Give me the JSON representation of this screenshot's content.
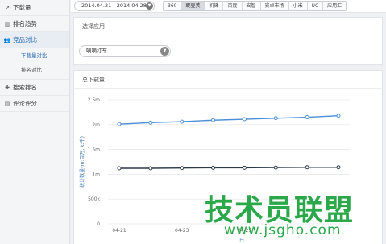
{
  "sidebar": {
    "items": [
      {
        "label": "下载量",
        "icon": "line-chart-icon"
      },
      {
        "label": "排名趋势",
        "icon": "bar-chart-icon"
      },
      {
        "label": "竞品对比",
        "icon": "users-icon",
        "active": true,
        "subitems": [
          {
            "label": "下载量对比",
            "active": true
          },
          {
            "label": "排名对比"
          }
        ]
      },
      {
        "label": "搜索排名",
        "icon": "cross-icon"
      },
      {
        "label": "评论评分",
        "icon": "comment-icon"
      }
    ]
  },
  "topbar": {
    "date_range": "2014.04.21 - 2014.04.28",
    "stores": [
      "360",
      "豌豆荚",
      "机锋",
      "百度",
      "安智",
      "安卓市场",
      "小米",
      "UC",
      "应用汇"
    ],
    "active_store": "豌豆荚"
  },
  "app_panel": {
    "title": "选择应用",
    "selected_app": "嘀嘀打车"
  },
  "download_panel": {
    "title": "总下载量"
  },
  "chart_data": {
    "type": "line",
    "ylabel": "统计数量(m:百万, k:千)",
    "xlabel": "日",
    "y_tick_labels": [
      "0",
      "500k",
      "1m",
      "1.5m",
      "2m",
      "2.5m"
    ],
    "ylim": [
      0,
      2500000
    ],
    "x_tick_labels": [
      "04-21",
      "04-23",
      "04-25"
    ],
    "x": [
      "04-21",
      "04-22",
      "04-23",
      "04-24",
      "04-25",
      "04-26",
      "04-27",
      "04-28"
    ],
    "series": [
      {
        "color": "#4a8fd8",
        "values": [
          2010000,
          2040000,
          2060000,
          2090000,
          2110000,
          2130000,
          2150000,
          2180000
        ]
      },
      {
        "color": "#2c3a4a",
        "values": [
          1120000,
          1120000,
          1125000,
          1130000,
          1130000,
          1135000,
          1140000,
          1140000
        ]
      }
    ],
    "grid": true
  },
  "watermark": {
    "main": "技术员联盟",
    "sub": "www.jsgho.com"
  }
}
